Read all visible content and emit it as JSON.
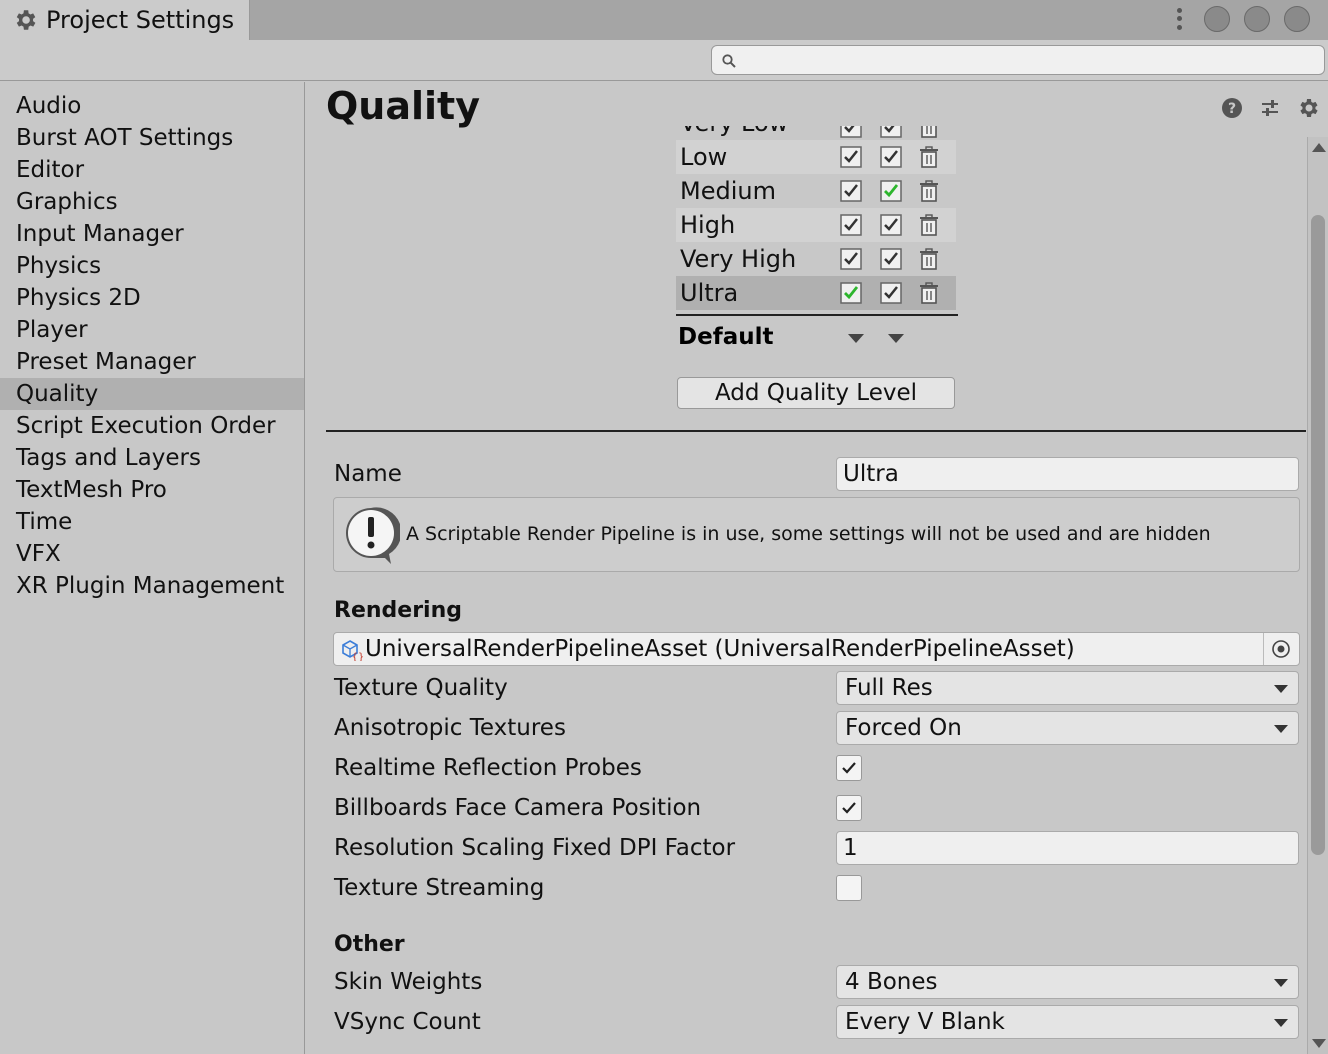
{
  "window": {
    "title": "Project Settings"
  },
  "search": {
    "placeholder": "",
    "value": ""
  },
  "sidebar": {
    "selected": "Quality",
    "items": [
      {
        "label": "Audio"
      },
      {
        "label": "Burst AOT Settings"
      },
      {
        "label": "Editor"
      },
      {
        "label": "Graphics"
      },
      {
        "label": "Input Manager"
      },
      {
        "label": "Physics"
      },
      {
        "label": "Physics 2D"
      },
      {
        "label": "Player"
      },
      {
        "label": "Preset Manager"
      },
      {
        "label": "Quality"
      },
      {
        "label": "Script Execution Order"
      },
      {
        "label": "Tags and Layers"
      },
      {
        "label": "TextMesh Pro"
      },
      {
        "label": "Time"
      },
      {
        "label": "VFX"
      },
      {
        "label": "XR Plugin Management"
      }
    ]
  },
  "main": {
    "title": "Quality",
    "header_icons": [
      "help-icon",
      "preset-sliders-icon",
      "gear-icon"
    ],
    "quality_levels": [
      {
        "name": "Very Low",
        "pc": true,
        "standalone": true,
        "pc_default": false,
        "standalone_default": false
      },
      {
        "name": "Low",
        "pc": true,
        "standalone": true,
        "pc_default": false,
        "standalone_default": false
      },
      {
        "name": "Medium",
        "pc": true,
        "standalone": true,
        "pc_default": false,
        "standalone_default": true
      },
      {
        "name": "High",
        "pc": true,
        "standalone": true,
        "pc_default": false,
        "standalone_default": false
      },
      {
        "name": "Very High",
        "pc": true,
        "standalone": true,
        "pc_default": false,
        "standalone_default": false
      },
      {
        "name": "Ultra",
        "pc": true,
        "standalone": true,
        "pc_default": true,
        "standalone_default": false
      }
    ],
    "default_label": "Default",
    "add_level_label": "Add Quality Level",
    "name_label": "Name",
    "name_value": "Ultra",
    "warning_text": "A Scriptable Render Pipeline is in use, some settings will not be used and are hidden",
    "rendering_header": "Rendering",
    "render_pipeline_asset": "UniversalRenderPipelineAsset (UniversalRenderPipelineAsset)",
    "texture_quality": {
      "label": "Texture Quality",
      "value": "Full Res"
    },
    "anisotropic": {
      "label": "Anisotropic Textures",
      "value": "Forced On"
    },
    "realtime_reflection": {
      "label": "Realtime Reflection Probes",
      "checked": true
    },
    "billboards": {
      "label": "Billboards Face Camera Position",
      "checked": true
    },
    "resolution_dpi": {
      "label": "Resolution Scaling Fixed DPI Factor",
      "value": "1"
    },
    "texture_streaming": {
      "label": "Texture Streaming",
      "checked": false
    },
    "other_header": "Other",
    "skin_weights": {
      "label": "Skin Weights",
      "value": "4 Bones"
    },
    "vsync": {
      "label": "VSync Count",
      "value": "Every V Blank"
    }
  },
  "colors": {
    "default_check": "#2db52d",
    "panel_bg": "#c8c8c8",
    "selected_bg": "#b0b0b0"
  }
}
